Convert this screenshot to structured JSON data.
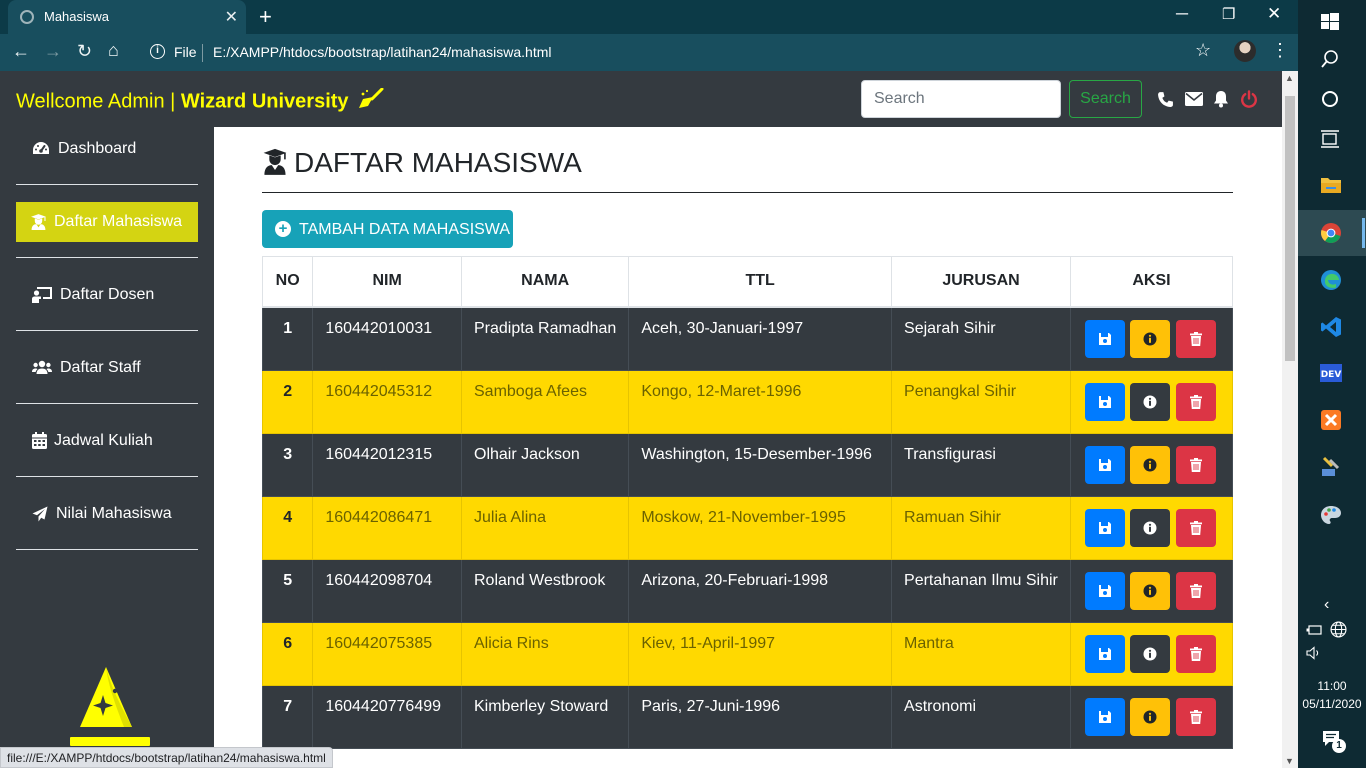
{
  "browser": {
    "tab_title": "Mahasiswa",
    "omnibox_file": "File",
    "url": "E:/XAMPP/htdocs/bootstrap/latihan24/mahasiswa.html",
    "status_url": "file:///E:/XAMPP/htdocs/bootstrap/latihan24/mahasiswa.html"
  },
  "navbar": {
    "brand_plain": "Wellcome Admin | ",
    "brand_bold": "Wizard University",
    "search_placeholder": "Search",
    "search_button": "Search",
    "icons": [
      "phone-icon",
      "envelope-icon",
      "bell-icon",
      "power-icon"
    ]
  },
  "sidebar": {
    "items": [
      {
        "label": "Dashboard",
        "icon": "tachometer-icon",
        "active": false
      },
      {
        "label": "Daftar Mahasiswa",
        "icon": "graduate-icon",
        "active": true
      },
      {
        "label": "Daftar Dosen",
        "icon": "chalkboard-teacher-icon",
        "active": false
      },
      {
        "label": "Daftar Staff",
        "icon": "users-icon",
        "active": false
      },
      {
        "label": "Jadwal Kuliah",
        "icon": "calendar-icon",
        "active": false
      },
      {
        "label": "Nilai Mahasiswa",
        "icon": "paper-plane-icon",
        "active": false
      }
    ]
  },
  "main": {
    "title": "DAFTAR MAHASISWA",
    "add_button": "TAMBAH DATA MAHASISWA",
    "columns": [
      "NO",
      "NIM",
      "NAMA",
      "TTL",
      "JURUSAN",
      "AKSI"
    ],
    "rows": [
      {
        "no": "1",
        "nim": "160442010031",
        "nama": "Pradipta Ramadhan",
        "ttl": "Aceh, 30-Januari-1997",
        "jurusan": "Sejarah Sihir"
      },
      {
        "no": "2",
        "nim": "160442045312",
        "nama": "Samboga Afees",
        "ttl": "Kongo, 12-Maret-1996",
        "jurusan": "Penangkal Sihir"
      },
      {
        "no": "3",
        "nim": "160442012315",
        "nama": "Olhair Jackson",
        "ttl": "Washington, 15-Desember-1996",
        "jurusan": "Transfigurasi"
      },
      {
        "no": "4",
        "nim": "160442086471",
        "nama": "Julia Alina",
        "ttl": "Moskow, 21-November-1995",
        "jurusan": "Ramuan Sihir"
      },
      {
        "no": "5",
        "nim": "160442098704",
        "nama": "Roland Westbrook",
        "ttl": "Arizona, 20-Februari-1998",
        "jurusan": "Pertahanan Ilmu Sihir"
      },
      {
        "no": "6",
        "nim": "160442075385",
        "nama": "Alicia Rins",
        "ttl": "Kiev, 11-April-1997",
        "jurusan": "Mantra"
      },
      {
        "no": "7",
        "nim": "1604420776499",
        "nama": "Kimberley Stoward",
        "ttl": "Paris, 27-Juni-1996",
        "jurusan": "Astronomi"
      }
    ]
  },
  "taskbar": {
    "time": "11:00",
    "date": "05/11/2020",
    "notification_count": "1"
  },
  "colors": {
    "brand": "#ffff00",
    "sidebar_active": "#d4d412",
    "row_dark": "#343a40",
    "row_yellow": "#ffd900",
    "btn_save": "#007bff",
    "btn_info": "#ffc107",
    "btn_delete": "#dc3545",
    "btn_add": "#17a2b8"
  }
}
